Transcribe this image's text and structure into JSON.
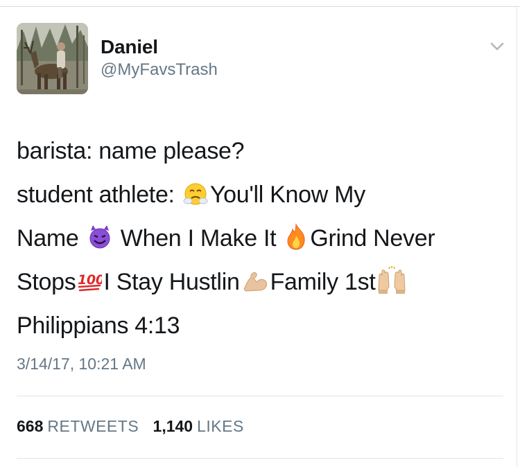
{
  "user": {
    "display_name": "Daniel",
    "handle": "@MyFavsTrash"
  },
  "icons": {
    "menu": "chevron-down-icon",
    "avatar": "avatar-photo"
  },
  "tweet": {
    "lines": [
      [
        "barista: name please?"
      ],
      [
        "student athlete: ",
        {
          "emoji": "face-with-steam-from-nose"
        },
        "You'll Know My"
      ],
      [
        "Name ",
        {
          "emoji": "smiling-face-with-horns"
        },
        " When I Make It ",
        {
          "emoji": "fire"
        },
        "Grind Never"
      ],
      [
        "Stops",
        {
          "emoji": "hundred-points"
        },
        "I Stay Hustlin",
        {
          "emoji": "flexed-biceps"
        },
        "Family 1st",
        {
          "emoji": "raising-hands"
        }
      ],
      [
        "Philippians 4:13"
      ]
    ]
  },
  "timestamp": "3/14/17, 10:21 AM",
  "stats": {
    "retweets_count": "668",
    "retweets_label": "RETWEETS",
    "likes_count": "1,140",
    "likes_label": "LIKES"
  },
  "colors": {
    "text": "#14171a",
    "secondary": "#657786",
    "divider": "#e1e5e8"
  }
}
